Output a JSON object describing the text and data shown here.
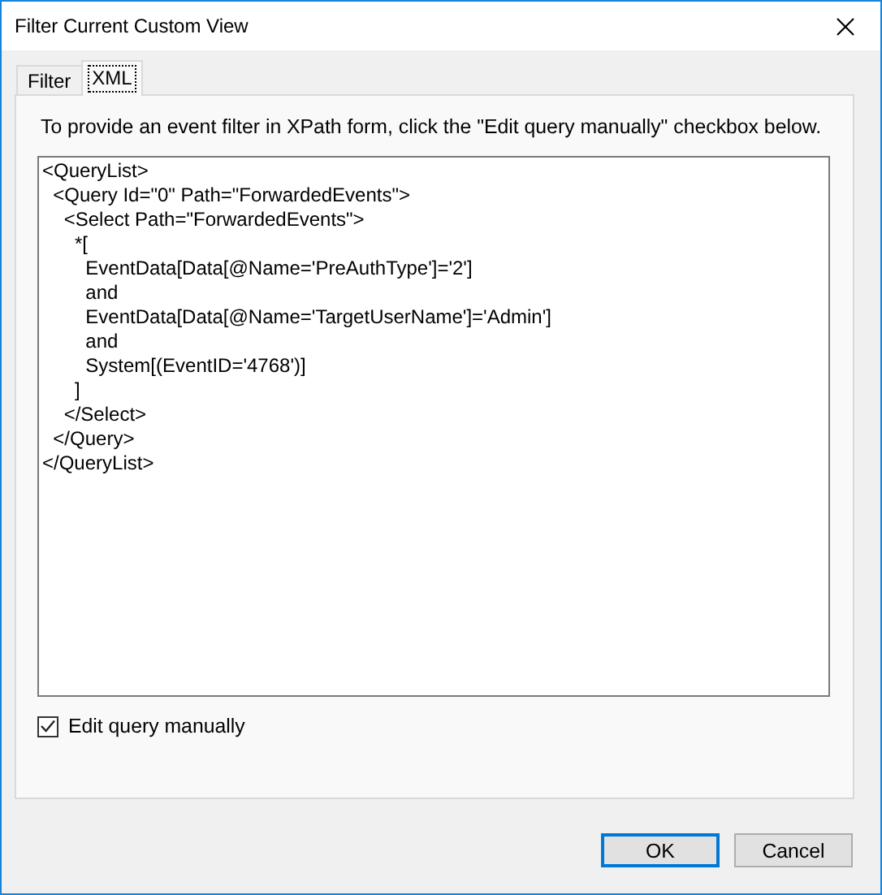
{
  "window": {
    "title": "Filter Current Custom View"
  },
  "tabs": [
    {
      "label": "Filter",
      "selected": false
    },
    {
      "label": "XML",
      "selected": true
    }
  ],
  "instructions": "To provide an event filter in XPath form, click the \"Edit query manually\" checkbox below.",
  "query": {
    "value": "<QueryList>\n  <Query Id=\"0\" Path=\"ForwardedEvents\">\n    <Select Path=\"ForwardedEvents\">\n      *[\n        EventData[Data[@Name='PreAuthType']='2']\n        and\n        EventData[Data[@Name='TargetUserName']='Admin']\n        and\n        System[(EventID='4768')]\n      ]\n    </Select>\n  </Query>\n</QueryList>"
  },
  "edit_manually": {
    "label": "Edit query manually",
    "checked": true
  },
  "buttons": [
    {
      "label": "OK",
      "default": true
    },
    {
      "label": "Cancel",
      "default": false
    }
  ]
}
